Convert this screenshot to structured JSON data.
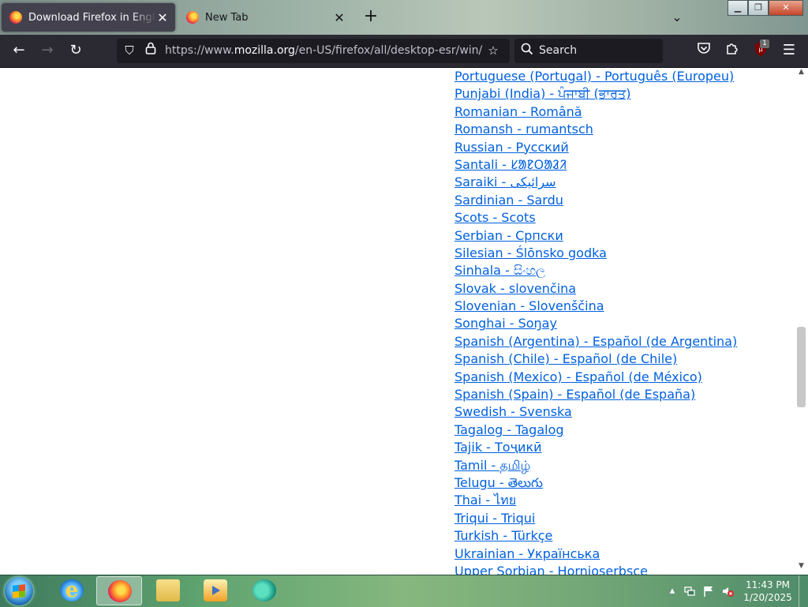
{
  "browser": {
    "tabs": [
      {
        "title": "Download Firefox in English (US)",
        "active": true
      },
      {
        "title": "New Tab",
        "active": false
      }
    ],
    "new_tab_symbol": "+",
    "list_tabs_symbol": "⌄",
    "window_controls": {
      "minimize": "▁",
      "maximize": "❐",
      "close": "✕"
    }
  },
  "navbar": {
    "back": "←",
    "forward": "→",
    "reload": "↻",
    "url_prefix": "https://www.",
    "url_domain": "mozilla.org",
    "url_path": "/en-US/firefox/all/desktop-esr/win/",
    "search_placeholder": "Search",
    "extensions_badge": "1"
  },
  "languages": [
    "Portuguese (Portugal) - Português (Europeu)",
    "Punjabi (India) - ਪੰਜਾਬੀ (ਭਾਰਤ)",
    "Romanian - Română",
    "Romansh - rumantsch",
    "Russian - Русский",
    "Santali - ᱥᱟᱱᱛᱟᱲᱤ",
    "Saraiki - سرائیکی",
    "Sardinian - Sardu",
    "Scots - Scots",
    "Serbian - Српски",
    "Silesian - Ślōnsko godka",
    "Sinhala - සිංහල",
    "Slovak - slovenčina",
    "Slovenian - Slovenščina",
    "Songhai - Soŋay",
    "Spanish (Argentina) - Español (de Argentina)",
    "Spanish (Chile) - Español (de Chile)",
    "Spanish (Mexico) - Español (de México)",
    "Spanish (Spain) - Español (de España)",
    "Swedish - Svenska",
    "Tagalog - Tagalog",
    "Tajik - Тоҷикӣ",
    "Tamil - தமிழ்",
    "Telugu - తెలుగు",
    "Thai - ไทย",
    "Triqui - Triqui",
    "Turkish - Türkçe",
    "Ukrainian - Українська",
    "Upper Sorbian - Hornjoserbsce"
  ],
  "taskbar": {
    "time": "11:43 PM",
    "date": "1/20/2025"
  }
}
